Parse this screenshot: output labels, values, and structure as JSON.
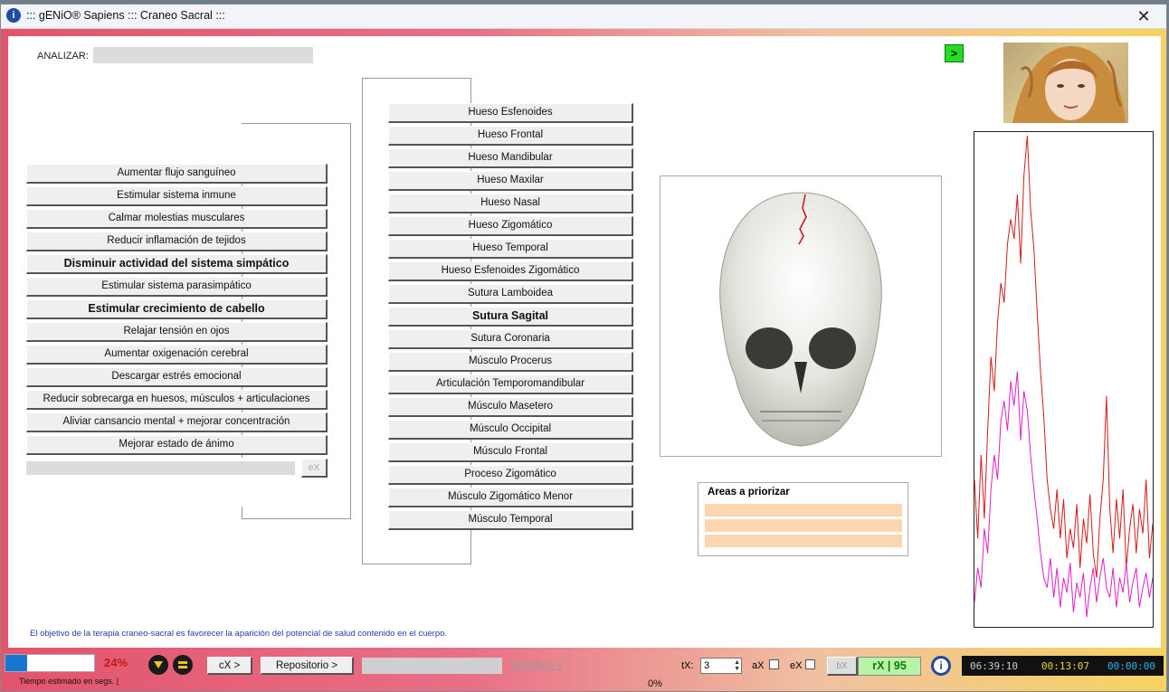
{
  "window": {
    "title": "::: gENiO® Sapiens ::: Craneo Sacral :::",
    "title_icon": "info-icon",
    "close_label": "✕"
  },
  "analyze": {
    "label": "ANALIZAR:",
    "value": ""
  },
  "go_button": {
    "label": ">",
    "color": "#22dd22"
  },
  "left_buttons": [
    {
      "label": "Aumentar flujo sanguíneo",
      "bold": false
    },
    {
      "label": "Estimular sistema inmune",
      "bold": false
    },
    {
      "label": "Calmar molestias musculares",
      "bold": false
    },
    {
      "label": "Reducir inflamación de tejidos",
      "bold": false
    },
    {
      "label": "Disminuir actividad del sistema simpático",
      "bold": true
    },
    {
      "label": "Estimular sistema parasimpático",
      "bold": false
    },
    {
      "label": "Estimular crecimiento de cabello",
      "bold": true
    },
    {
      "label": "Relajar tensión en ojos",
      "bold": false
    },
    {
      "label": "Aumentar oxigenación cerebral",
      "bold": false
    },
    {
      "label": "Descargar estrés emocional",
      "bold": false
    },
    {
      "label": "Reducir sobrecarga en huesos, músculos + articulaciones",
      "bold": false
    },
    {
      "label": "Aliviar cansancio mental + mejorar concentración",
      "bold": false
    },
    {
      "label": "Mejorar estado de ánimo",
      "bold": false
    }
  ],
  "left_input": {
    "value": "",
    "ex_label": "eX"
  },
  "middle_buttons": [
    {
      "label": "Hueso Esfenoides",
      "bold": false
    },
    {
      "label": "Hueso Frontal",
      "bold": false
    },
    {
      "label": "Hueso Mandibular",
      "bold": false
    },
    {
      "label": "Hueso Maxilar",
      "bold": false
    },
    {
      "label": "Hueso Nasal",
      "bold": false
    },
    {
      "label": "Hueso Zigomático",
      "bold": false
    },
    {
      "label": "Hueso Temporal",
      "bold": false
    },
    {
      "label": "Hueso Esfenoides Zigomático",
      "bold": false
    },
    {
      "label": "Sutura Lamboidea",
      "bold": false
    },
    {
      "label": "Sutura Sagital",
      "bold": true
    },
    {
      "label": "Sutura Coronaria",
      "bold": false
    },
    {
      "label": "Músculo Procerus",
      "bold": false
    },
    {
      "label": "Articulación Temporomandibular",
      "bold": false
    },
    {
      "label": "Músculo Masetero",
      "bold": false
    },
    {
      "label": "Músculo Occipital",
      "bold": false
    },
    {
      "label": "Músculo Frontal",
      "bold": false
    },
    {
      "label": "Proceso Zigomático",
      "bold": false
    },
    {
      "label": "Músculo Zigomático Menor",
      "bold": false
    },
    {
      "label": "Músculo Temporal",
      "bold": false
    }
  ],
  "areas": {
    "title": "Areas a priorizar",
    "rows": [
      "",
      "",
      ""
    ],
    "row_color": "#fdd5b1"
  },
  "footer_note": "El objetivo de la terapia craneo-sacral es favorecer la aparición del potencial de salud contenido en el cuerpo.",
  "bottom": {
    "progress_percent": "24%",
    "progress_fraction": 0.24,
    "estimate_label": "Tiempo estimado en segs. |",
    "cx_label": "cX >",
    "repo_label": "Repositorio >",
    "transfer_label": "Transferir >",
    "transfer_percent": "0%",
    "tx_label": "tX:",
    "tx_value": "3",
    "ax_label": "aX",
    "ex_label": "eX",
    "bx_label": "bX",
    "rx_label": "rX | 95",
    "timers": [
      "06:39:10",
      "00:13:07",
      "00:00:00"
    ],
    "timer_colors": [
      "#cccccc",
      "#f0d23a",
      "#29b6f6"
    ]
  },
  "chart_data": {
    "type": "line",
    "series": [
      {
        "color": "#d41a1a",
        "values": [
          0.3,
          0.18,
          0.35,
          0.22,
          0.4,
          0.55,
          0.48,
          0.62,
          0.7,
          0.66,
          0.78,
          0.83,
          0.79,
          0.88,
          0.74,
          0.92,
          1.0,
          0.85,
          0.77,
          0.64,
          0.52,
          0.43,
          0.3,
          0.24,
          0.2,
          0.28,
          0.18,
          0.26,
          0.14,
          0.2,
          0.16,
          0.25,
          0.12,
          0.22,
          0.17,
          0.27,
          0.15,
          0.1,
          0.22,
          0.3,
          0.47,
          0.24,
          0.15,
          0.26,
          0.18,
          0.28,
          0.12,
          0.2,
          0.25,
          0.15,
          0.24,
          0.19,
          0.3,
          0.14,
          0.21
        ]
      },
      {
        "color": "#e01ec8",
        "values": [
          0.05,
          0.12,
          0.08,
          0.2,
          0.15,
          0.28,
          0.35,
          0.3,
          0.42,
          0.46,
          0.4,
          0.5,
          0.45,
          0.52,
          0.38,
          0.48,
          0.44,
          0.35,
          0.28,
          0.22,
          0.15,
          0.1,
          0.08,
          0.14,
          0.06,
          0.12,
          0.04,
          0.1,
          0.07,
          0.13,
          0.03,
          0.09,
          0.06,
          0.11,
          0.02,
          0.08,
          0.12,
          0.05,
          0.1,
          0.14,
          0.08,
          0.06,
          0.12,
          0.04,
          0.1,
          0.07,
          0.13,
          0.05,
          0.09,
          0.12,
          0.04,
          0.08,
          0.11,
          0.06,
          0.1
        ]
      }
    ]
  }
}
